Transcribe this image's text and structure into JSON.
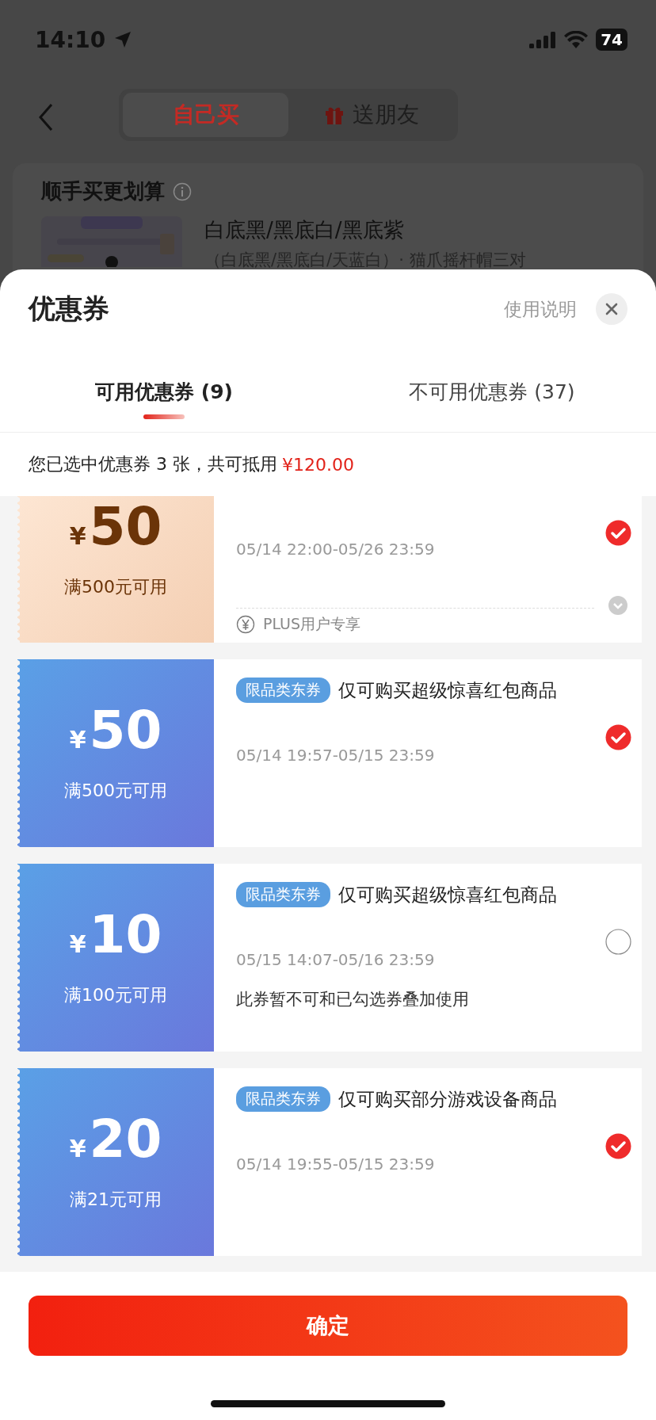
{
  "status_bar": {
    "time": "14:10",
    "battery": "74"
  },
  "nav": {
    "segments": [
      {
        "label": "自己买",
        "selected": true
      },
      {
        "label": "送朋友",
        "selected": false
      }
    ]
  },
  "background_card": {
    "title": "顺手买更划算",
    "product": {
      "kind": "picture",
      "title": "白底黑/黑底白/黑底紫",
      "subtitle": "（白底黑/黑底白/天蓝白）· 猫爪摇杆帽三对"
    }
  },
  "sheet": {
    "title": "优惠券",
    "help_link": "使用说明",
    "tabs": [
      {
        "label": "可用优惠券 (9)",
        "selected": true
      },
      {
        "label": "不可用优惠券 (37)",
        "selected": false
      }
    ],
    "summary": "您已选中优惠券 3 张，共可抵用",
    "summary_amount": "¥120.00",
    "coupons": [
      {
        "kind": "plus",
        "currency": "¥",
        "amount": "50",
        "condition": "满500元可用",
        "validity": "05/14 22:00-05/26 23:59",
        "footer": "PLUS用户专享",
        "selected": true
      },
      {
        "kind": "standard",
        "currency": "¥",
        "amount": "50",
        "condition": "满500元可用",
        "tag": "限品类东券",
        "description": "仅可购买超级惊喜红包商品",
        "validity": "05/14 19:57-05/15 23:59",
        "selected": true
      },
      {
        "kind": "standard",
        "currency": "¥",
        "amount": "10",
        "condition": "满100元可用",
        "tag": "限品类东券",
        "description": "仅可购买超级惊喜红包商品",
        "validity": "05/15 14:07-05/16 23:59",
        "note": "此券暂不可和已勾选券叠加使用",
        "selected": false
      },
      {
        "kind": "standard",
        "currency": "¥",
        "amount": "20",
        "condition": "满21元可用",
        "tag": "限品类东券",
        "description": "仅可购买部分游戏设备商品",
        "validity": "05/14 19:55-05/15 23:59",
        "selected": true
      }
    ],
    "confirm_button": "确定"
  }
}
